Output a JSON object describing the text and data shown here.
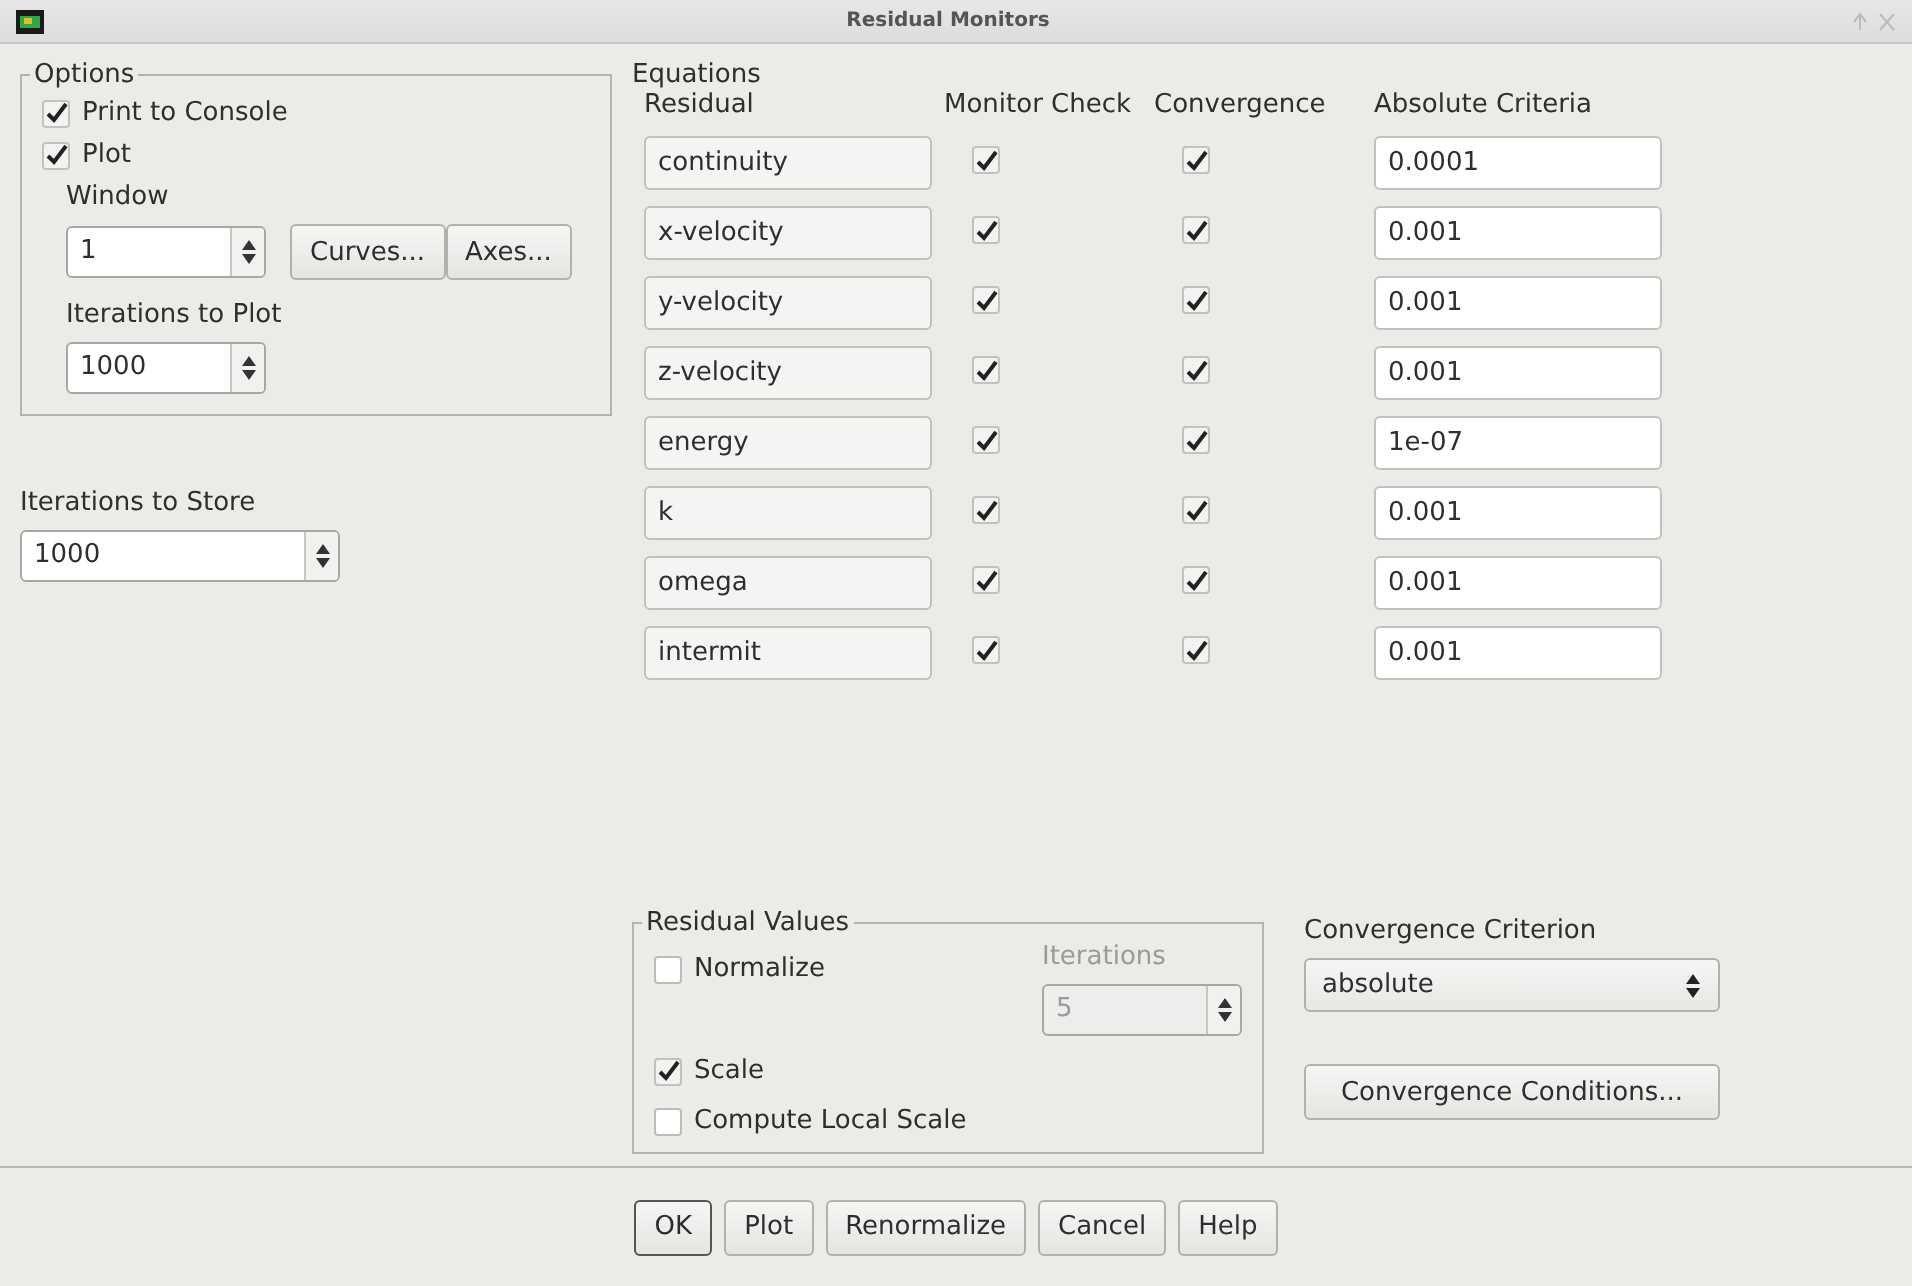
{
  "window": {
    "title": "Residual Monitors"
  },
  "options": {
    "title": "Options",
    "checks": [
      {
        "label": "Print to Console",
        "checked": true
      },
      {
        "label": "Plot",
        "checked": true
      }
    ],
    "window_label": "Window",
    "window_value": "1",
    "buttons": [
      "Curves...",
      "Axes..."
    ],
    "iter_plot_label": "Iterations to Plot",
    "iter_plot_value": "1000"
  },
  "iter_store": {
    "label": "Iterations to Store",
    "value": "1000"
  },
  "equations": {
    "title": "Equations",
    "columns": [
      "Residual",
      "Monitor Check",
      "Convergence",
      "Absolute Criteria"
    ],
    "rows": [
      {
        "residual": "continuity",
        "monitor": true,
        "convergence": true,
        "criteria": "0.0001"
      },
      {
        "residual": "x-velocity",
        "monitor": true,
        "convergence": true,
        "criteria": "0.001"
      },
      {
        "residual": "y-velocity",
        "monitor": true,
        "convergence": true,
        "criteria": "0.001"
      },
      {
        "residual": "z-velocity",
        "monitor": true,
        "convergence": true,
        "criteria": "0.001"
      },
      {
        "residual": "energy",
        "monitor": true,
        "convergence": true,
        "criteria": "1e-07"
      },
      {
        "residual": "k",
        "monitor": true,
        "convergence": true,
        "criteria": "0.001"
      },
      {
        "residual": "omega",
        "monitor": true,
        "convergence": true,
        "criteria": "0.001"
      },
      {
        "residual": "intermit",
        "monitor": true,
        "convergence": true,
        "criteria": "0.001"
      }
    ]
  },
  "residual_values": {
    "title": "Residual Values",
    "normalize": {
      "label": "Normalize",
      "checked": false
    },
    "iterations_label": "Iterations",
    "iterations_value": "5",
    "iterations_disabled": true,
    "scale": {
      "label": "Scale",
      "checked": true
    },
    "local_scale": {
      "label": "Compute Local Scale",
      "checked": false
    }
  },
  "criterion": {
    "label": "Convergence Criterion",
    "value": "absolute",
    "conditions_button": "Convergence Conditions..."
  },
  "buttons": [
    {
      "label": "OK",
      "default": true
    },
    {
      "label": "Plot",
      "default": false
    },
    {
      "label": "Renormalize",
      "default": false
    },
    {
      "label": "Cancel",
      "default": false
    },
    {
      "label": "Help",
      "default": false
    }
  ]
}
